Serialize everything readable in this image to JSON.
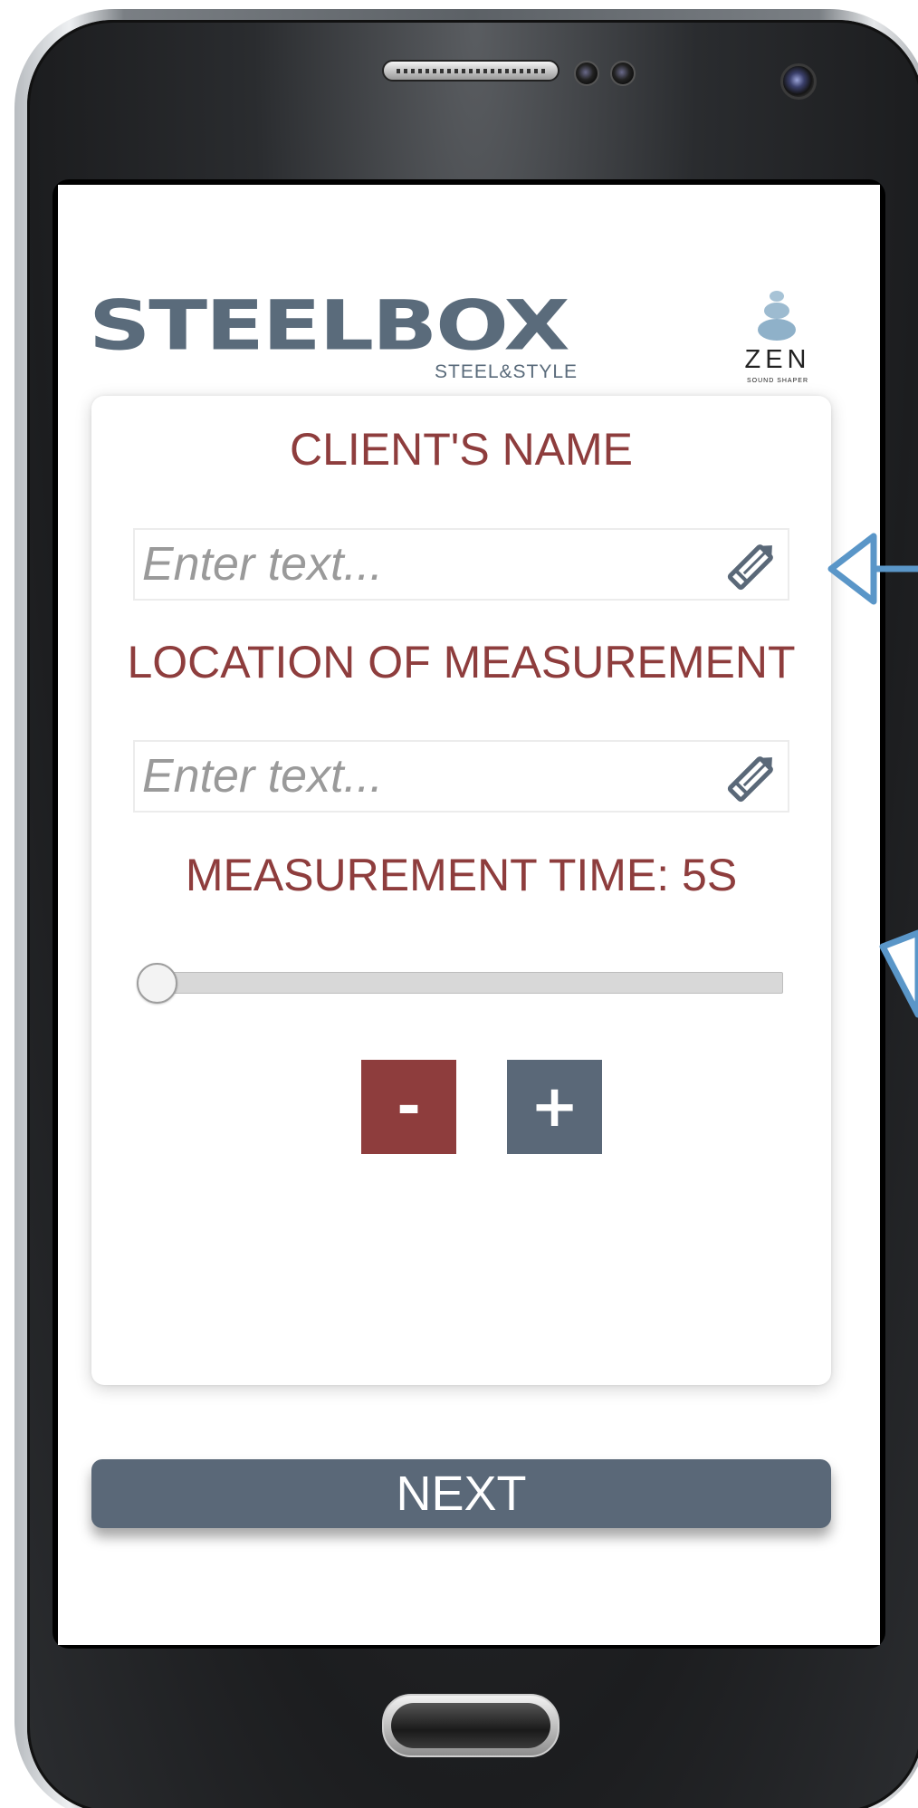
{
  "header": {
    "brand": "STEELBOX",
    "tagline": "STEEL&STYLE",
    "partner_logo": "ZEN",
    "partner_sub": "SOUND SHAPER"
  },
  "form": {
    "client_name_label": "CLIENT'S NAME",
    "client_name": {
      "value": "",
      "placeholder": "Enter text..."
    },
    "location_label": "LOCATION OF MEASUREMENT",
    "location": {
      "value": "",
      "placeholder": "Enter text..."
    },
    "time_label": "MEASUREMENT TIME: 5S",
    "time_slider": {
      "value_fraction": 0.0
    },
    "minus_label": "-",
    "plus_label": "+"
  },
  "next_label": "NEXT",
  "icons": {
    "edit": "pencil-icon",
    "minus": "minus",
    "plus": "plus"
  },
  "colors": {
    "label_red": "#8e3d3d",
    "brand_slate": "#5a6878",
    "annotation_blue": "#5a96c8"
  }
}
